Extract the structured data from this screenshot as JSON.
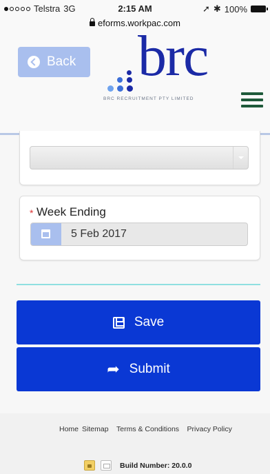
{
  "status_bar": {
    "carrier": "Telstra",
    "network": "3G",
    "time": "2:15 AM",
    "battery": "100%",
    "url": "eforms.workpac.com"
  },
  "header": {
    "back_label": "Back",
    "logo_text": "brc",
    "logo_subtitle": "BRC RECRUITMENT PTY LIMITED"
  },
  "form": {
    "select_value": "",
    "week_ending_label": "Week Ending",
    "required_marker": "*",
    "week_ending_value": "5 Feb 2017"
  },
  "actions": {
    "save_label": "Save",
    "submit_label": "Submit"
  },
  "footer": {
    "links": [
      "Home",
      "Sitemap",
      "Terms & Conditions",
      "Privacy Policy"
    ],
    "build_number": "Build Number: 20.0.0"
  },
  "colors": {
    "primary_button": "#0a38d4",
    "back_button": "#a9bfee",
    "logo_blue": "#1b2aa6",
    "menu_green": "#1e5a3a",
    "divider": "#8fdfe0"
  },
  "icons": [
    "back-arrow-icon",
    "menu-icon",
    "calendar-icon",
    "save-icon",
    "share-icon",
    "lock-icon",
    "mail-icon"
  ]
}
